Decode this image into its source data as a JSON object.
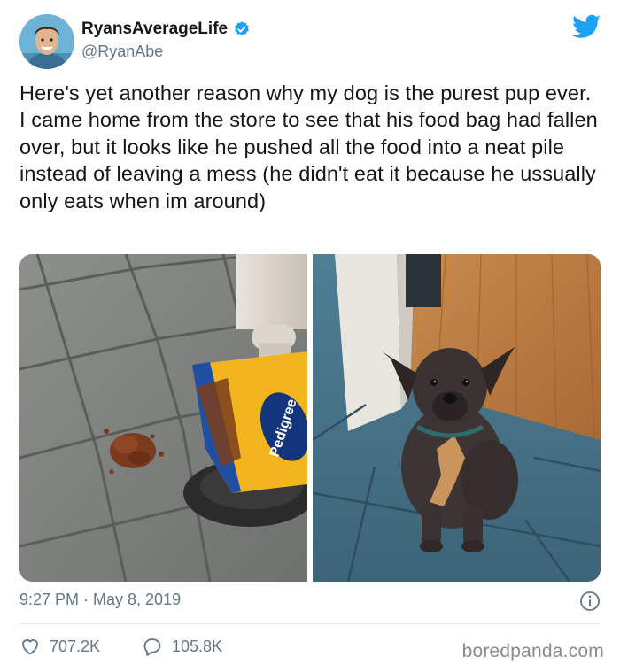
{
  "tweet": {
    "author_name": "RyansAverageLife",
    "handle": "@RyanAbe",
    "text": "Here's yet another reason why my dog is the purest pup ever. I came home from the store to see that his food bag had fallen over, but it looks like he pushed all the food into a neat pile instead of leaving a mess (he didn't eat it because he ussually only eats when im around)",
    "timestamp": "9:27 PM · May 8, 2019",
    "likes": "707.2K",
    "replies": "105.8K",
    "bag_brand": "Pedigree"
  },
  "icons": {
    "verified": "verified-badge-icon",
    "platform": "twitter-bird-icon",
    "info": "info-icon",
    "like": "heart-icon",
    "reply": "reply-bubble-icon"
  },
  "colors": {
    "brand_blue": "#1da1f2",
    "text": "#14171a",
    "secondary_text": "#657786"
  },
  "watermark": "boredpanda.com"
}
